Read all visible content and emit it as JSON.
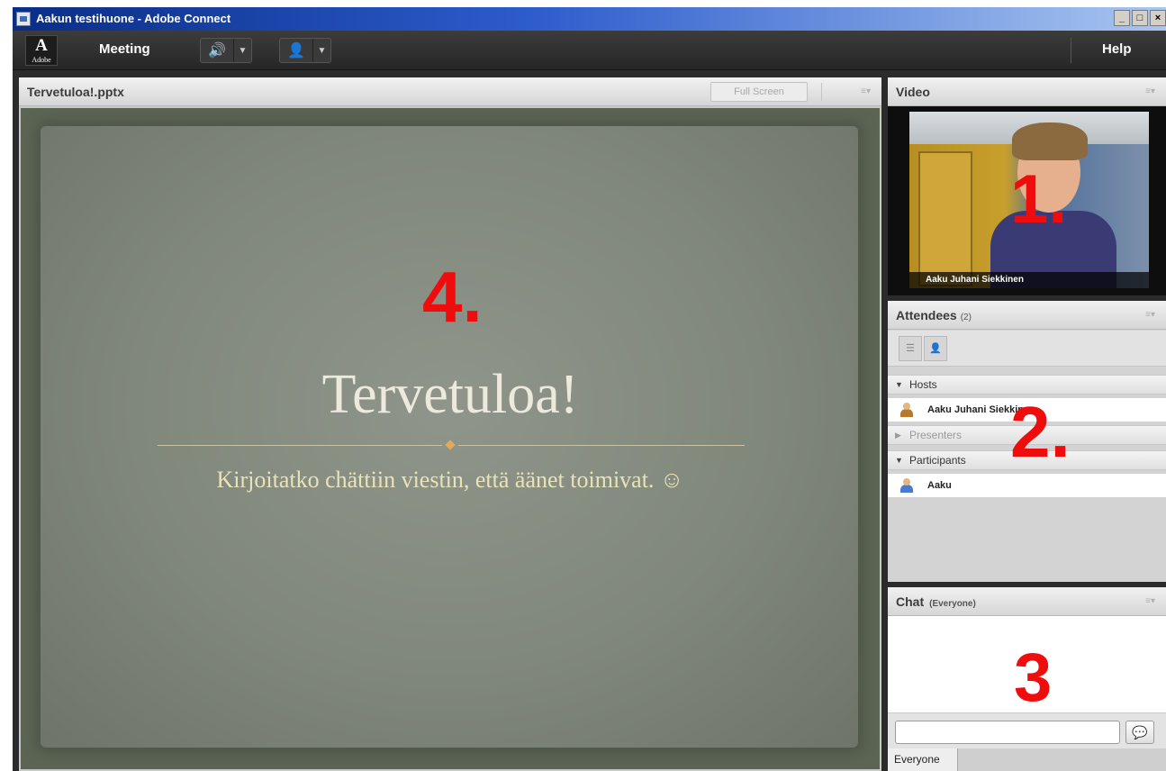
{
  "window": {
    "title": "Aakun testihuone - Adobe Connect",
    "controls": [
      "_",
      "□",
      "×"
    ]
  },
  "menubar": {
    "logo": {
      "glyph": "A",
      "word": "Adobe"
    },
    "meeting_label": "Meeting",
    "audio_icon": "speaker-icon",
    "camera_icon": "person-icon",
    "help_label": "Help"
  },
  "share_pod": {
    "title": "Tervetuloa!.pptx",
    "fullscreen_label": "Full Screen",
    "slide": {
      "heading": "Tervetuloa!",
      "subtitle": "Kirjoitatko chättiin viestin, että äänet toimivat. ☺"
    },
    "annotation": "4."
  },
  "video_pod": {
    "title": "Video",
    "caption": "Aaku Juhani Siekkinen",
    "annotation": "1."
  },
  "attendees_pod": {
    "title": "Attendees",
    "count": "(2)",
    "sections": {
      "hosts": "Hosts",
      "presenters": "Presenters",
      "participants": "Participants"
    },
    "hosts": [
      "Aaku Juhani Siekkinen"
    ],
    "participants": [
      "Aaku"
    ],
    "annotation": "2."
  },
  "chat_pod": {
    "title": "Chat",
    "subtitle": "(Everyone)",
    "input_value": "",
    "tab_label": "Everyone",
    "annotation": "3"
  },
  "colors": {
    "annotation": "#ef0c0c",
    "titlebar": "#0a2e86",
    "menubar": "#2b2b2b",
    "slide_background": "#80877b",
    "speaker_icon": "#4cd137"
  }
}
